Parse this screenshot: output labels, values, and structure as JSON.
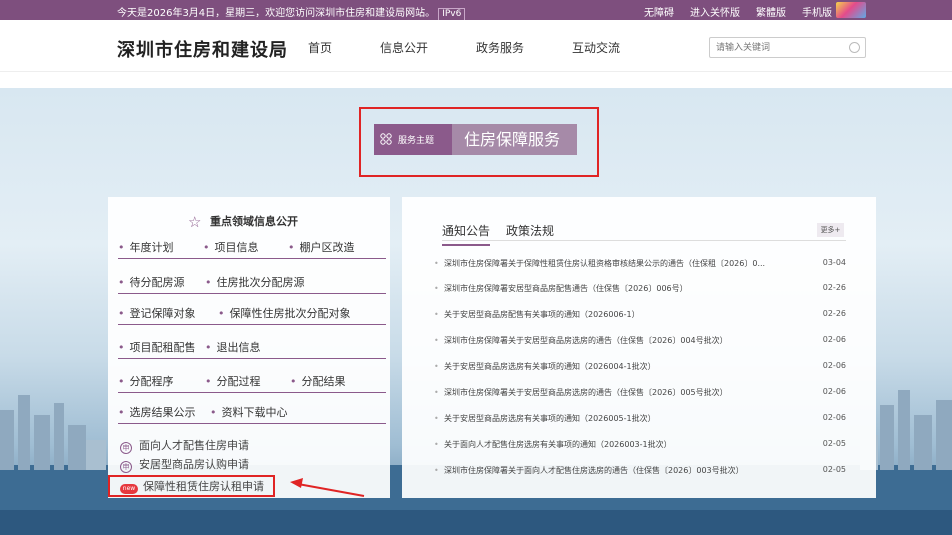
{
  "topbar": {
    "welcome": "今天是2026年3月4日，星期三，欢迎您访问深圳市住房和建设局网站。",
    "ipv6": "IPv6",
    "links": [
      "无障碍",
      "进入关怀版",
      "繁體版",
      "手机版"
    ]
  },
  "header": {
    "brand": "深圳市住房和建设局",
    "nav": [
      "首页",
      "信息公开",
      "政务服务",
      "互动交流"
    ],
    "search_placeholder": "请输入关键词"
  },
  "theme": {
    "tag": "服务主题",
    "title": "住房保障服务"
  },
  "left_panel": {
    "title": "重点领域信息公开",
    "rows": [
      [
        "年度计划",
        "项目信息",
        "棚户区改造"
      ],
      [
        "待分配房源",
        "住房批次分配房源"
      ],
      [
        "登记保障对象",
        "保障性住房批次分配对象"
      ],
      [
        "项目配租配售",
        "退出信息"
      ],
      [
        "分配程序",
        "分配过程",
        "分配结果"
      ],
      [
        "选房结果公示",
        "资料下载中心"
      ]
    ],
    "apply_items": [
      {
        "icon": "申",
        "label": "面向人才配售住房申请"
      },
      {
        "icon": "申",
        "label": "安居型商品房认购申请"
      },
      {
        "icon": "new",
        "label": "保障性租赁住房认租申请"
      }
    ]
  },
  "right_panel": {
    "tabs": [
      "通知公告",
      "政策法规"
    ],
    "more": "更多+",
    "news": [
      {
        "title": "深圳市住房保障署关于保障性租赁住房认租资格审核结果公示的通告（住保租〔2026〕0...",
        "date": "03-04"
      },
      {
        "title": "深圳市住房保障署安居型商品房配售通告（住保售〔2026〕006号）",
        "date": "02-26"
      },
      {
        "title": "关于安居型商品房配售有关事项的通知（2026006-1）",
        "date": "02-26"
      },
      {
        "title": "深圳市住房保障署关于安居型商品房选房的通告（住保售〔2026〕004号批次）",
        "date": "02-06"
      },
      {
        "title": "关于安居型商品房选房有关事项的通知（2026004-1批次）",
        "date": "02-06"
      },
      {
        "title": "深圳市住房保障署关于安居型商品房选房的通告（住保售〔2026〕005号批次）",
        "date": "02-06"
      },
      {
        "title": "关于安居型商品房选房有关事项的通知（2026005-1批次）",
        "date": "02-06"
      },
      {
        "title": "关于面向人才配售住房选房有关事项的通知（2026003-1批次）",
        "date": "02-05"
      },
      {
        "title": "深圳市住房保障署关于面向人才配售住房选房的通告（住保售〔2026〕003号批次）",
        "date": "02-05"
      }
    ]
  },
  "colors": {
    "brand_purple": "#7e4f7e",
    "accent_purple": "#8b5a8b",
    "annotation_red": "#e02424"
  }
}
